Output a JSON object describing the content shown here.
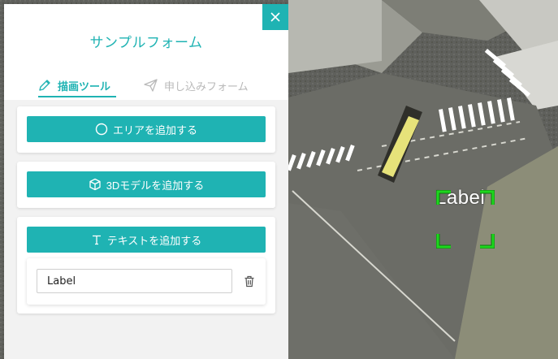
{
  "panel": {
    "title": "サンプルフォーム",
    "tabs": [
      {
        "label": "描画ツール",
        "icon": "pencil-icon",
        "active": true
      },
      {
        "label": "申し込みフォーム",
        "icon": "send-icon",
        "active": false
      }
    ],
    "buttons": {
      "add_area": "エリアを追加する",
      "add_3d_model": "3Dモデルを追加する",
      "add_text": "テキストを追加する"
    },
    "text_item": {
      "value": "Label"
    }
  },
  "map": {
    "label_text": "Label"
  },
  "colors": {
    "accent": "#1fb3b3",
    "selection": "#1ed61e"
  }
}
